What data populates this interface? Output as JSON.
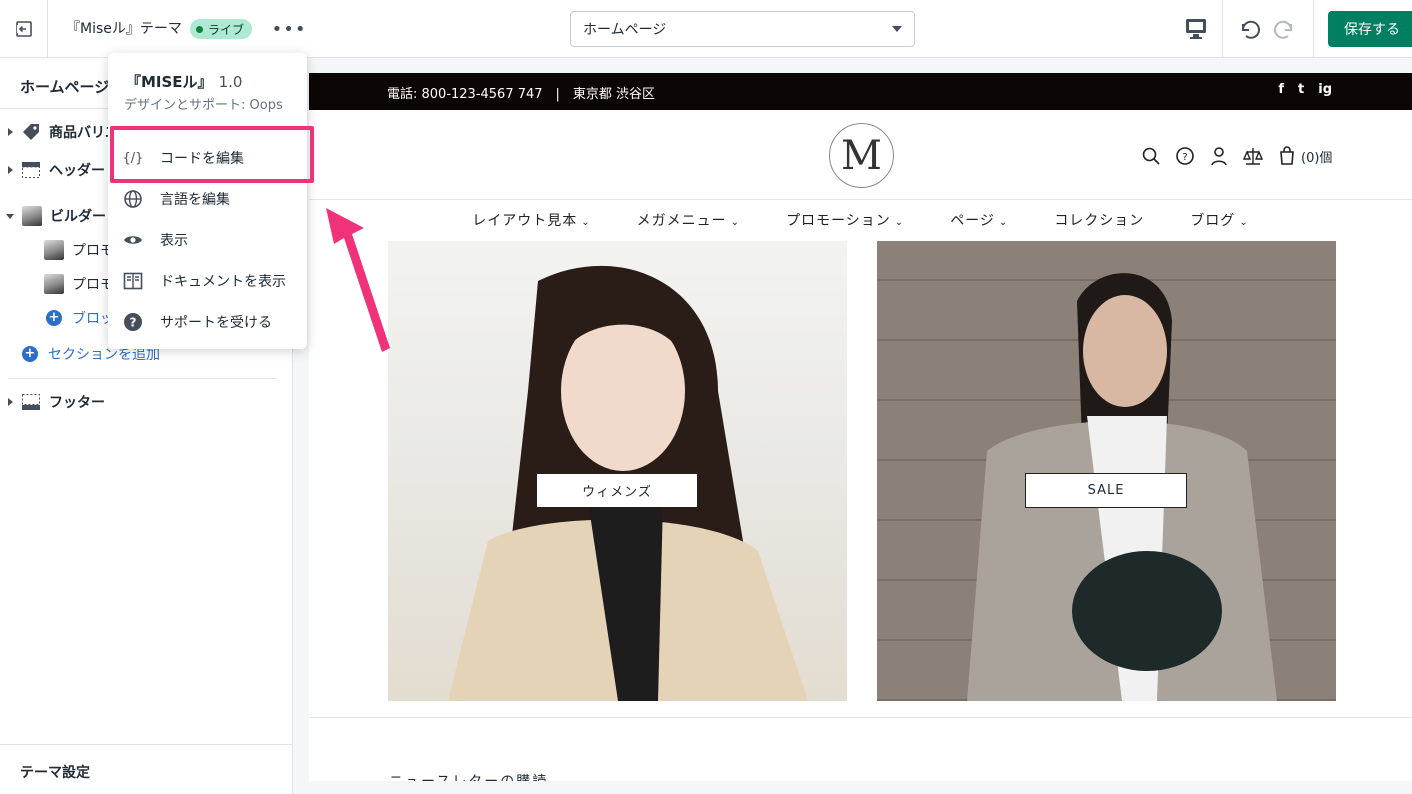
{
  "topbar": {
    "theme_name": "『Miseル』テーマ",
    "live_label": "ライブ",
    "more": "•••",
    "page_select_value": "ホームページ",
    "save_label": "保存する"
  },
  "sidebar": {
    "title": "ホームページ",
    "items": [
      {
        "label": "商品バリエ"
      },
      {
        "label": "ヘッダー"
      },
      {
        "label": "ビルダー"
      },
      {
        "label": "プロモ"
      },
      {
        "label": "プロモ"
      },
      {
        "label": "ブロッ"
      },
      {
        "label": "セクションを追加"
      },
      {
        "label": "フッター"
      }
    ],
    "settings": "テーマ設定"
  },
  "preview": {
    "announcement": "電話: 800-123-4567 747　|　東京都 渋谷区",
    "social": [
      "f",
      "t",
      "ig"
    ],
    "logo": "M",
    "cart": "(0)個",
    "nav": [
      "レイアウト見本",
      "メガメニュー",
      "プロモーション",
      "ページ",
      "コレクション",
      "ブログ"
    ],
    "promo1_label": "ウィメンズ",
    "promo2_label": "SALE",
    "newsletter": "ニュースレターの購読"
  },
  "popover": {
    "title": "『MISEル』",
    "version": "1.0",
    "subtitle": "デザインとサポート: Oops",
    "items": [
      {
        "label": "コードを編集",
        "icon": "code-icon"
      },
      {
        "label": "言語を編集",
        "icon": "globe-icon"
      },
      {
        "label": "表示",
        "icon": "eye-icon"
      },
      {
        "label": "ドキュメントを表示",
        "icon": "book-icon"
      },
      {
        "label": "サポートを受ける",
        "icon": "question-icon"
      }
    ]
  },
  "colors": {
    "accent": "#008060",
    "live_badge": "#aee9d1",
    "highlight": "#f0327a",
    "link": "#2c6ecb"
  }
}
